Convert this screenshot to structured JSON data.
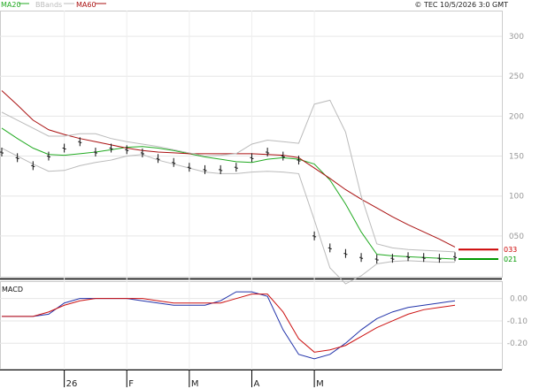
{
  "legend": {
    "ma20": {
      "label": "MA20",
      "color": "#22aa22"
    },
    "bbands": {
      "label": "BBands",
      "color": "#bbbbbb"
    },
    "ma60": {
      "label": "MA60",
      "color": "#aa1111"
    }
  },
  "copyright": "© TEC 10/5/2026 3:0 GMT",
  "chart_data": [
    {
      "type": "line",
      "panel": "price",
      "y_ticks": [
        "300",
        "250",
        "200",
        "150",
        "100",
        "050"
      ],
      "ylim": [
        0,
        330
      ],
      "last_price_labels": [
        {
          "text": "033",
          "value": 33,
          "color": "#cc0000"
        },
        {
          "text": "021",
          "value": 21,
          "color": "#009900"
        }
      ],
      "series": [
        {
          "name": "MA20",
          "color": "#22aa22",
          "values": [
            185,
            172,
            160,
            152,
            151,
            153,
            155,
            158,
            161,
            162,
            160,
            157,
            153,
            149,
            146,
            143,
            142,
            146,
            148,
            146,
            140,
            120,
            90,
            55,
            27,
            25,
            24,
            23,
            22,
            21
          ]
        },
        {
          "name": "MA60",
          "color": "#aa1111",
          "values": [
            232,
            214,
            195,
            183,
            177,
            172,
            168,
            164,
            160,
            157,
            155,
            154,
            153,
            153,
            153,
            153,
            153,
            152,
            151,
            148,
            135,
            122,
            108,
            96,
            85,
            74,
            64,
            55,
            46,
            36
          ]
        },
        {
          "name": "BBands upper",
          "color": "#bbbbbb",
          "values": [
            205,
            195,
            185,
            175,
            175,
            178,
            178,
            172,
            168,
            165,
            162,
            158,
            154,
            150,
            151,
            153,
            165,
            170,
            168,
            166,
            215,
            220,
            180,
            100,
            40,
            35,
            33,
            32,
            31,
            30
          ]
        },
        {
          "name": "BBands lower",
          "color": "#bbbbbb",
          "values": [
            160,
            150,
            140,
            131,
            132,
            138,
            142,
            145,
            150,
            152,
            145,
            140,
            135,
            130,
            128,
            128,
            130,
            131,
            130,
            128,
            70,
            10,
            -10,
            0,
            15,
            18,
            19,
            18,
            17,
            17
          ]
        },
        {
          "name": "Price",
          "color": "#111111",
          "values": [
            155,
            148,
            138,
            150,
            160,
            168,
            155,
            160,
            158,
            154,
            147,
            142,
            136,
            133,
            133,
            136,
            148,
            155,
            150,
            145,
            50,
            35,
            28,
            23,
            21,
            22,
            24,
            23,
            22,
            24
          ]
        }
      ]
    },
    {
      "type": "line",
      "panel": "macd",
      "title": "MACD",
      "y_ticks": [
        "0.00",
        "-0.10",
        "-0.20"
      ],
      "ylim": [
        -0.31,
        0.07
      ],
      "series": [
        {
          "name": "MACD",
          "color": "#2233aa",
          "values": [
            -0.08,
            -0.08,
            -0.08,
            -0.07,
            -0.02,
            0.0,
            0.0,
            0.0,
            0.0,
            -0.01,
            -0.02,
            -0.03,
            -0.03,
            -0.03,
            -0.01,
            0.03,
            0.03,
            0.01,
            -0.14,
            -0.25,
            -0.27,
            -0.25,
            -0.2,
            -0.14,
            -0.09,
            -0.06,
            -0.04,
            -0.03,
            -0.02,
            -0.01
          ]
        },
        {
          "name": "Signal",
          "color": "#cc1111",
          "values": [
            -0.08,
            -0.08,
            -0.08,
            -0.06,
            -0.03,
            -0.01,
            0.0,
            0.0,
            0.0,
            0.0,
            -0.01,
            -0.02,
            -0.02,
            -0.02,
            -0.02,
            0.0,
            0.02,
            0.02,
            -0.06,
            -0.18,
            -0.24,
            -0.23,
            -0.21,
            -0.17,
            -0.13,
            -0.1,
            -0.07,
            -0.05,
            -0.04,
            -0.03
          ]
        }
      ]
    }
  ],
  "x_axis": {
    "labels": [
      "26",
      "F",
      "M",
      "A",
      "M"
    ],
    "label_index": [
      4,
      8,
      12,
      16,
      20
    ]
  }
}
